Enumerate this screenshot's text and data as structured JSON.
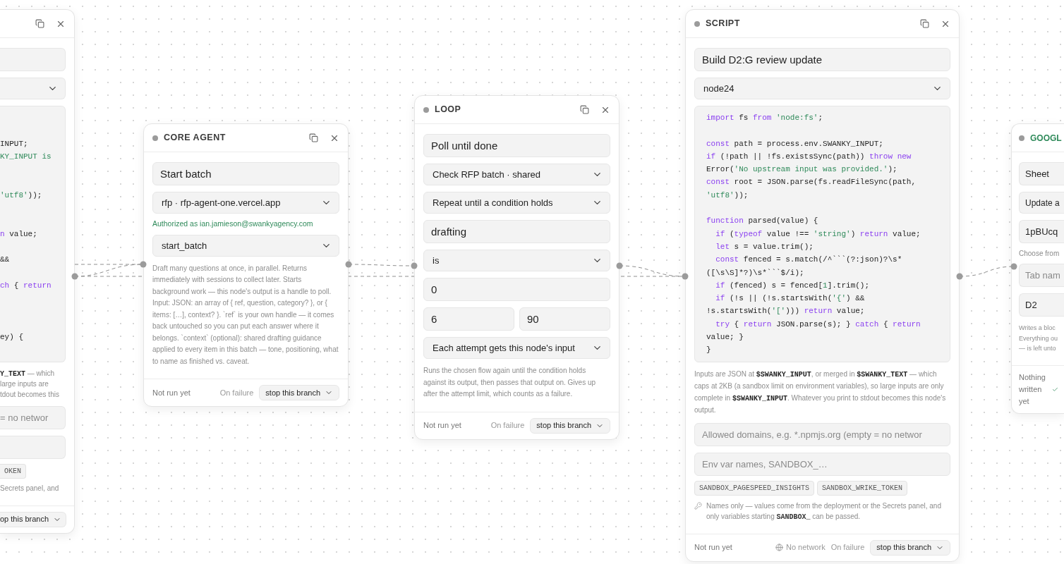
{
  "nodes": [
    {
      "fields": [
        {
          "kind": "input"
        },
        {
          "kind": "select"
        },
        {
          "kind": "code",
          "lines": [
            {
              "kind": "blank"
            },
            {
              "kind": "blank"
            },
            {
              "kind": "code",
              "segments": [
                {
                  "kind": "plain",
                  "text": "INPUT;"
                }
              ]
            },
            {
              "kind": "code",
              "segments": [
                {
                  "kind": "str",
                  "text": "KY_INPUT is"
                }
              ]
            },
            {
              "kind": "blank"
            },
            {
              "kind": "blank"
            },
            {
              "kind": "code",
              "segments": [
                {
                  "kind": "str",
                  "text": "'utf8'"
                },
                {
                  "kind": "plain",
                  "text": "));"
                }
              ]
            },
            {
              "kind": "blank"
            },
            {
              "kind": "blank"
            },
            {
              "kind": "code",
              "segments": [
                {
                  "kind": "kw",
                  "text": "n"
                },
                {
                  "kind": "plain",
                  "text": " value;"
                }
              ]
            },
            {
              "kind": "blank"
            },
            {
              "kind": "code",
              "segments": [
                {
                  "kind": "plain",
                  "text": "&&"
                }
              ]
            },
            {
              "kind": "blank"
            },
            {
              "kind": "code",
              "segments": [
                {
                  "kind": "kw",
                  "text": "ch"
                },
                {
                  "kind": "plain",
                  "text": " { "
                },
                {
                  "kind": "kw",
                  "text": "return"
                }
              ]
            },
            {
              "kind": "blank"
            },
            {
              "kind": "blank"
            },
            {
              "kind": "blank"
            },
            {
              "kind": "code",
              "segments": [
                {
                  "kind": "plain",
                  "text": "ey) {"
                }
              ]
            },
            {
              "kind": "blank"
            }
          ]
        },
        {
          "kind": "description",
          "lines": [
            "**Y_TEXT** — which",
            "large inputs are",
            "tdout becomes this"
          ]
        },
        {
          "kind": "input",
          "placeholder": "= no networ"
        },
        {
          "kind": "input"
        },
        {
          "kind": "chips",
          "items": [
            "OKEN"
          ]
        },
        {
          "kind": "description",
          "lines": [
            "Secrets panel, and"
          ]
        }
      ],
      "footer": {
        "failure_action": "op this branch",
        "ok": false
      }
    },
    {
      "title": "CORE AGENT",
      "color": "#3a3a3a",
      "fields": [
        {
          "kind": "input",
          "value": "Start batch"
        },
        {
          "kind": "select",
          "value": "rfp · rfp-agent-one.vercel.app"
        },
        {
          "kind": "auth",
          "text": "Authorized as ian.jamieson@swankyagency.com"
        },
        {
          "kind": "select",
          "value": "start_batch"
        },
        {
          "kind": "description",
          "text": "Draft many questions at once, in parallel. Returns immediately with sessions to collect later. Starts background work — this node's output is a handle to poll. Input: JSON: an array of { ref, question, category? }, or { items: […], context? }. `ref` is your own handle — it comes back untouched so you can put each answer where it belongs. `context` (optional): shared drafting guidance applied to every item in this batch — tone, positioning, what to name as finished vs. caveat."
        }
      ],
      "footer": {
        "status": "Not run yet",
        "failure_label": "On failure",
        "failure_action": "stop this branch",
        "ok": false
      }
    },
    {
      "title": "LOOP",
      "color": "#3a3a3a",
      "fields": [
        {
          "kind": "input",
          "value": "Poll until done"
        },
        {
          "kind": "select",
          "value": "Check RFP batch · shared"
        },
        {
          "kind": "select",
          "value": "Repeat until a condition holds"
        },
        {
          "kind": "input",
          "value": "drafting"
        },
        {
          "kind": "select",
          "value": "is"
        },
        {
          "kind": "input",
          "value": "0"
        },
        {
          "kind": "pair",
          "values": [
            "6",
            "90"
          ]
        },
        {
          "kind": "select",
          "value": "Each attempt gets this node's input"
        },
        {
          "kind": "description",
          "text": "Runs the chosen flow again until the condition holds against its output, then passes that output on. Gives up after the attempt limit, which counts as a failure."
        }
      ],
      "footer": {
        "status": "Not run yet",
        "failure_label": "On failure",
        "failure_action": "stop this branch",
        "ok": false
      }
    },
    {
      "title": "SCRIPT",
      "color": "#3a3a3a",
      "fields": [
        {
          "kind": "input",
          "value": "Build D2:G review update"
        },
        {
          "kind": "select",
          "value": "node24"
        },
        {
          "kind": "code",
          "lines": [
            {
              "kind": "code",
              "segments": [
                {
                  "kind": "kw",
                  "text": "import"
                },
                {
                  "kind": "plain",
                  "text": " fs "
                },
                {
                  "kind": "kw",
                  "text": "from"
                },
                {
                  "kind": "str",
                  "text": " 'node:fs'"
                },
                {
                  "kind": "plain",
                  "text": ";"
                }
              ]
            },
            {
              "kind": "blank"
            },
            {
              "kind": "code",
              "segments": [
                {
                  "kind": "kw",
                  "text": "const"
                },
                {
                  "kind": "plain",
                  "text": " path = process.env.SWANKY_INPUT;"
                }
              ]
            },
            {
              "kind": "code",
              "segments": [
                {
                  "kind": "kw",
                  "text": "if"
                },
                {
                  "kind": "plain",
                  "text": " (!path || !fs.existsSync(path)) "
                },
                {
                  "kind": "kw",
                  "text": "throw new"
                }
              ]
            },
            {
              "kind": "code",
              "segments": [
                {
                  "kind": "plain",
                  "text": "Error("
                },
                {
                  "kind": "str",
                  "text": "'No upstream input was provided.'"
                },
                {
                  "kind": "plain",
                  "text": ");"
                }
              ]
            },
            {
              "kind": "code",
              "segments": [
                {
                  "kind": "kw",
                  "text": "const"
                },
                {
                  "kind": "plain",
                  "text": " root = JSON.parse(fs.readFileSync(path,"
                }
              ]
            },
            {
              "kind": "code",
              "segments": [
                {
                  "kind": "str",
                  "text": "'utf8'"
                },
                {
                  "kind": "plain",
                  "text": "));"
                }
              ]
            },
            {
              "kind": "blank"
            },
            {
              "kind": "code",
              "segments": [
                {
                  "kind": "kw",
                  "text": "function"
                },
                {
                  "kind": "plain",
                  "text": " parsed(value) {"
                }
              ]
            },
            {
              "kind": "code",
              "segments": [
                {
                  "kind": "kw",
                  "text": "  if"
                },
                {
                  "kind": "plain",
                  "text": " ("
                },
                {
                  "kind": "kw",
                  "text": "typeof"
                },
                {
                  "kind": "plain",
                  "text": " value !== "
                },
                {
                  "kind": "str",
                  "text": "'string'"
                },
                {
                  "kind": "plain",
                  "text": ") "
                },
                {
                  "kind": "kw",
                  "text": "return"
                },
                {
                  "kind": "plain",
                  "text": " value;"
                }
              ]
            },
            {
              "kind": "code",
              "segments": [
                {
                  "kind": "kw",
                  "text": "  let"
                },
                {
                  "kind": "plain",
                  "text": " s = value.trim();"
                }
              ]
            },
            {
              "kind": "code",
              "segments": [
                {
                  "kind": "kw",
                  "text": "  const"
                },
                {
                  "kind": "plain",
                  "text": " fenced = s.match(/^```(?:json)?\\s*"
                }
              ]
            },
            {
              "kind": "code",
              "segments": [
                {
                  "kind": "plain",
                  "text": "([\\s\\S]*?)\\s*```$/i);"
                }
              ]
            },
            {
              "kind": "code",
              "segments": [
                {
                  "kind": "kw",
                  "text": "  if"
                },
                {
                  "kind": "plain",
                  "text": " (fenced) s = fenced["
                },
                {
                  "kind": "str",
                  "text": "1"
                },
                {
                  "kind": "plain",
                  "text": "].trim();"
                }
              ]
            },
            {
              "kind": "code",
              "segments": [
                {
                  "kind": "kw",
                  "text": "  if"
                },
                {
                  "kind": "plain",
                  "text": " (!s || (!s.startsWith("
                },
                {
                  "kind": "str",
                  "text": "'{'"
                },
                {
                  "kind": "plain",
                  "text": ") &&"
                }
              ]
            },
            {
              "kind": "code",
              "segments": [
                {
                  "kind": "plain",
                  "text": "!s.startsWith("
                },
                {
                  "kind": "str",
                  "text": "'['"
                },
                {
                  "kind": "plain",
                  "text": "))) "
                },
                {
                  "kind": "kw",
                  "text": "return"
                },
                {
                  "kind": "plain",
                  "text": " value;"
                }
              ]
            },
            {
              "kind": "code",
              "segments": [
                {
                  "kind": "kw",
                  "text": "  try"
                },
                {
                  "kind": "plain",
                  "text": " { "
                },
                {
                  "kind": "kw",
                  "text": "return"
                },
                {
                  "kind": "plain",
                  "text": " JSON.parse(s); } "
                },
                {
                  "kind": "kw",
                  "text": "catch"
                },
                {
                  "kind": "plain",
                  "text": " { "
                },
                {
                  "kind": "kw",
                  "text": "return"
                }
              ]
            },
            {
              "kind": "code",
              "segments": [
                {
                  "kind": "plain",
                  "text": "value; }"
                }
              ]
            },
            {
              "kind": "code",
              "segments": [
                {
                  "kind": "plain",
                  "text": "}"
                }
              ]
            }
          ]
        },
        {
          "kind": "description",
          "text": "Inputs are JSON at **$SWANKY_INPUT**, or merged in **$SWANKY_TEXT** — which caps at 2KB (a sandbox limit on environment variables), so large inputs are only complete in **$SWANKY_INPUT**. Whatever you print to stdout becomes this node's output."
        },
        {
          "kind": "input",
          "placeholder": "Allowed domains, e.g. *.npmjs.org (empty = no networ"
        },
        {
          "kind": "input",
          "placeholder": "Env var names, SANDBOX_…"
        },
        {
          "kind": "chips",
          "items": [
            "SANDBOX_PAGESPEED_INSIGHTS",
            "SANDBOX_WRIKE_TOKEN"
          ]
        },
        {
          "kind": "hint",
          "text": "Names only — values come from the deployment or the Secrets panel, and only variables starting **SANDBOX_** can be passed."
        }
      ],
      "footer": {
        "status": "Not run yet",
        "network": "No network",
        "failure_label": "On failure",
        "failure_action": "stop this branch",
        "ok": false
      }
    },
    {
      "title": "GOOGL",
      "color": "#2f8a5a",
      "fields": [
        {
          "kind": "input",
          "value": "Sheet"
        },
        {
          "kind": "select",
          "value": "Update a"
        },
        {
          "kind": "input",
          "value": "1pBUcq"
        },
        {
          "kind": "note",
          "text": "Choose from"
        },
        {
          "kind": "input",
          "placeholder": "Tab nam"
        },
        {
          "kind": "input",
          "value": "D2"
        },
        {
          "kind": "description",
          "lines": [
            "Writes a bloc",
            "Everything ou",
            "— is left unto"
          ]
        }
      ],
      "footer": {
        "status": "Nothing written yet",
        "ok": true
      }
    }
  ]
}
